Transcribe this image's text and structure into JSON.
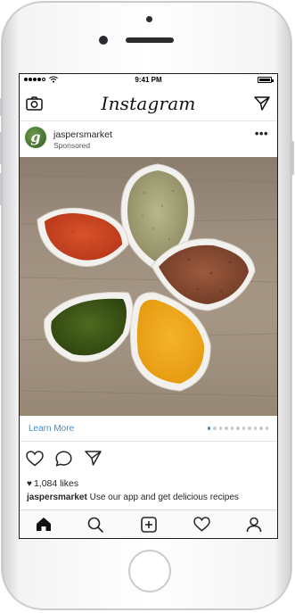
{
  "status_bar": {
    "time": "9:41 PM"
  },
  "header": {
    "app_title": "Instagram",
    "camera_icon": "camera-icon",
    "direct_icon": "paper-plane-icon"
  },
  "post": {
    "account": "jaspersmarket",
    "label": "Sponsored",
    "avatar_letter": "g",
    "more_menu": "•••",
    "image_subject": "Spices in teardrop-shaped bowls arranged like a flower",
    "cta": "Learn More",
    "carousel": {
      "count": 11,
      "active_index": 0
    },
    "likes_heart": "♥",
    "likes": "1,084 likes",
    "caption_user": "jaspersmarket",
    "caption_text": " Use our app and get delicious recipes"
  },
  "action_icons": [
    "heart-outline-icon",
    "comment-icon",
    "share-icon"
  ],
  "tabbar": {
    "items": [
      "home-icon",
      "search-icon",
      "add-post-icon",
      "activity-heart-icon",
      "profile-icon"
    ],
    "active": "home-icon"
  },
  "colors": {
    "link_blue": "#3c8fd6",
    "text": "#262626",
    "avatar_green": "#4b7c36"
  }
}
